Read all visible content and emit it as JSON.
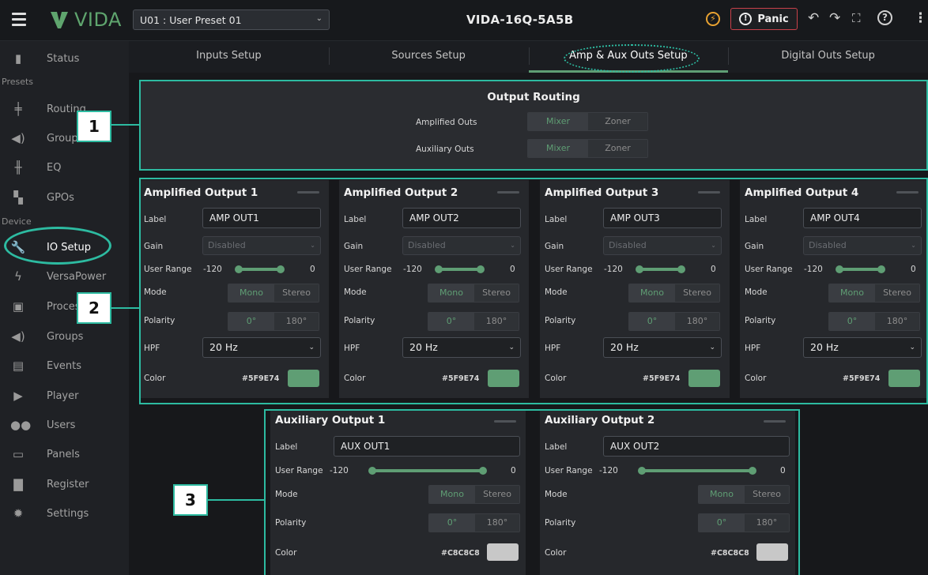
{
  "header": {
    "brand": "VIDA",
    "preset": "U01 : User Preset 01",
    "device_name": "VIDA-16Q-5A5B",
    "panic_label": "Panic"
  },
  "sidebar": {
    "sections": [
      "Presets",
      "Device"
    ],
    "items": [
      {
        "label": "Status",
        "icon": "bar-chart-icon"
      },
      {
        "label": "Routing",
        "icon": "signpost-icon"
      },
      {
        "label": "Group vol.",
        "icon": "speaker-icon"
      },
      {
        "label": "EQ",
        "icon": "sliders-icon"
      },
      {
        "label": "GPOs",
        "icon": "gpo-icon"
      },
      {
        "label": "IO Setup",
        "icon": "wrench-icon",
        "active": true
      },
      {
        "label": "VersaPower",
        "icon": "lightning-icon"
      },
      {
        "label": "Processing",
        "icon": "chip-icon"
      },
      {
        "label": "Groups",
        "icon": "speaker-icon"
      },
      {
        "label": "Events",
        "icon": "calendar-icon"
      },
      {
        "label": "Player",
        "icon": "play-icon"
      },
      {
        "label": "Users",
        "icon": "users-icon"
      },
      {
        "label": "Panels",
        "icon": "panel-icon"
      },
      {
        "label": "Register",
        "icon": "document-icon"
      },
      {
        "label": "Settings",
        "icon": "gear-icon"
      }
    ]
  },
  "tabs": [
    "Inputs Setup",
    "Sources Setup",
    "Amp & Aux Outs Setup",
    "Digital Outs Setup"
  ],
  "active_tab": "Amp & Aux Outs Setup",
  "routing": {
    "title": "Output Routing",
    "rows": [
      {
        "label": "Amplified Outs",
        "options": [
          "Mixer",
          "Zoner"
        ],
        "selected": "Mixer"
      },
      {
        "label": "Auxiliary Outs",
        "options": [
          "Mixer",
          "Zoner"
        ],
        "selected": "Mixer"
      }
    ]
  },
  "labels": {
    "label": "Label",
    "gain": "Gain",
    "user_range": "User Range",
    "mode": "Mode",
    "polarity": "Polarity",
    "hpf": "HPF",
    "color": "Color",
    "mono": "Mono",
    "stereo": "Stereo",
    "pol0": "0°",
    "pol180": "180°",
    "range_min": "-120",
    "range_max": "0"
  },
  "amp_outputs": [
    {
      "title": "Amplified Output 1",
      "label": "AMP OUT1",
      "gain": "Disabled",
      "hpf": "20 Hz",
      "color_hex": "#5F9E74",
      "swatch": "#5f9e74",
      "mode": "Mono",
      "polarity": "0°"
    },
    {
      "title": "Amplified Output 2",
      "label": "AMP OUT2",
      "gain": "Disabled",
      "hpf": "20 Hz",
      "color_hex": "#5F9E74",
      "swatch": "#5f9e74",
      "mode": "Mono",
      "polarity": "0°"
    },
    {
      "title": "Amplified Output 3",
      "label": "AMP OUT3",
      "gain": "Disabled",
      "hpf": "20 Hz",
      "color_hex": "#5F9E74",
      "swatch": "#5f9e74",
      "mode": "Mono",
      "polarity": "0°"
    },
    {
      "title": "Amplified Output 4",
      "label": "AMP OUT4",
      "gain": "Disabled",
      "hpf": "20 Hz",
      "color_hex": "#5F9E74",
      "swatch": "#5f9e74",
      "mode": "Mono",
      "polarity": "0°"
    }
  ],
  "aux_outputs": [
    {
      "title": "Auxiliary Output 1",
      "label": "AUX OUT1",
      "color_hex": "#C8C8C8",
      "swatch": "#c8c8c8",
      "mode": "Mono",
      "polarity": "0°"
    },
    {
      "title": "Auxiliary Output 2",
      "label": "AUX OUT2",
      "color_hex": "#C8C8C8",
      "swatch": "#c8c8c8",
      "mode": "Mono",
      "polarity": "0°"
    }
  ],
  "annotations": [
    "1",
    "2",
    "3"
  ],
  "colors": {
    "accent": "#5f9e74",
    "callout": "#2dbba1",
    "panic": "#c9414a",
    "power": "#e8a231"
  }
}
